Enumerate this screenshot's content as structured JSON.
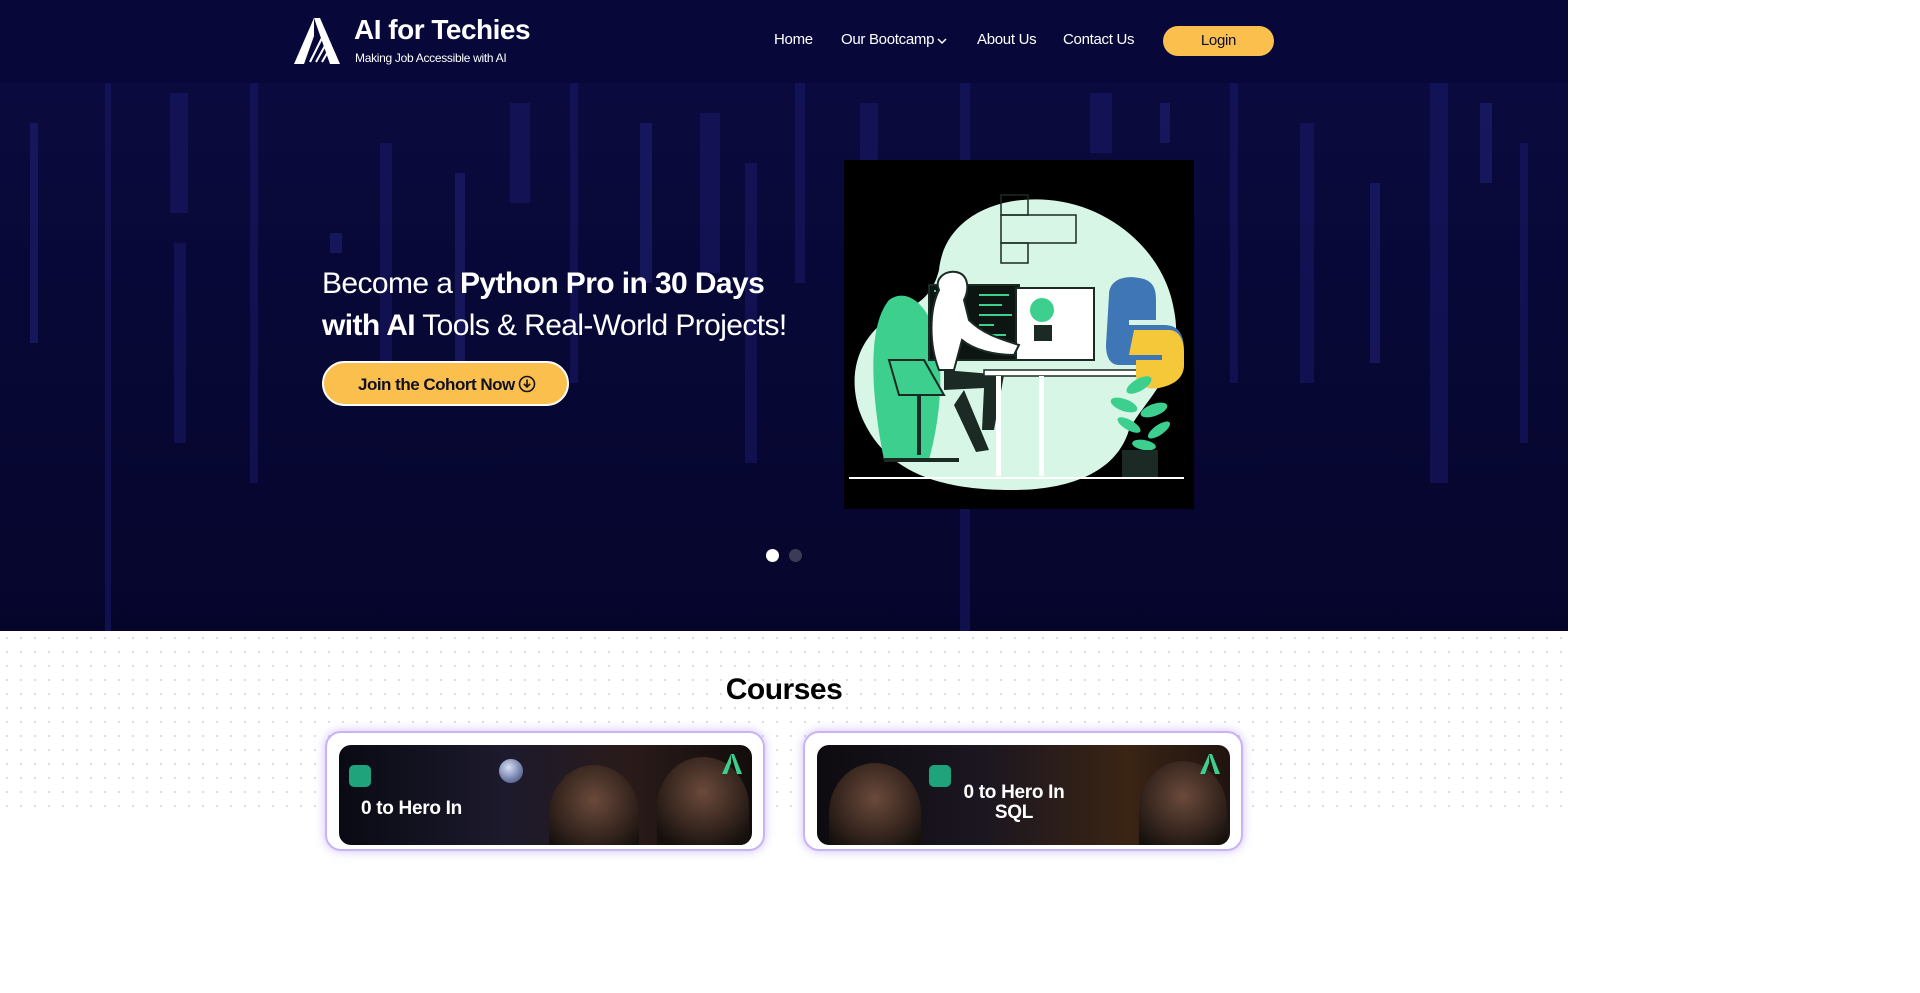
{
  "header": {
    "brand_title": "AI for Techies",
    "brand_tagline": "Making Job Accessible with AI",
    "nav": {
      "home": "Home",
      "bootcamp": "Our Bootcamp",
      "about": "About Us",
      "contact": "Contact Us"
    },
    "login_label": "Login"
  },
  "hero": {
    "title_part1": "Become a ",
    "title_bold1": "Python Pro in 30 Days with AI",
    "title_part2": " Tools & Real-World Projects!",
    "cta_label": "Join the Cohort Now",
    "carousel": {
      "slides": 2,
      "active": 1
    }
  },
  "courses": {
    "title": "Courses",
    "cards": [
      {
        "thumb_text": "0 to Hero In"
      },
      {
        "thumb_text": "0 to Hero In SQL"
      }
    ]
  },
  "colors": {
    "header_bg": "#07073a",
    "hero_bg": "#08083a",
    "accent_yellow": "#fbbf4d",
    "illustration_green": "#4ecf98",
    "card_border": "#c8b4f5"
  },
  "icons": [
    "logo-icon",
    "chevron-down-icon",
    "download-circle-icon",
    "openai-icon",
    "python-icon"
  ]
}
